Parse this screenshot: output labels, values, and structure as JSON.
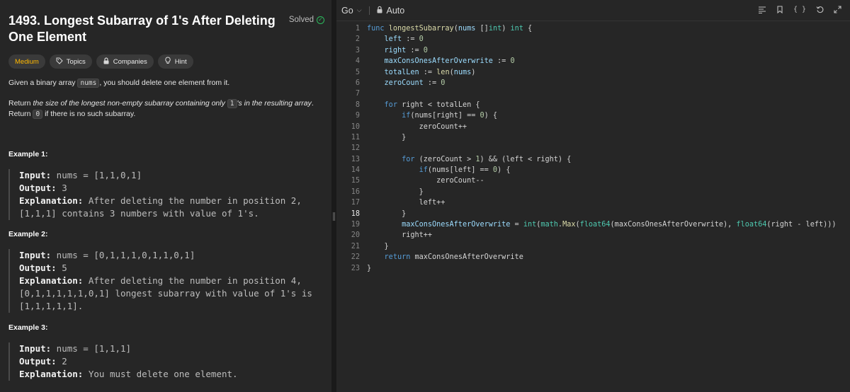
{
  "problem": {
    "title": "1493. Longest Subarray of 1's After Deleting One Element",
    "status": "Solved",
    "tags": {
      "difficulty": "Medium",
      "topics": "Topics",
      "companies": "Companies",
      "hint": "Hint"
    },
    "description": {
      "p1_pre": "Given a binary array ",
      "p1_code": "nums",
      "p1_post": ", you should delete one element from it.",
      "p2_pre": "Return ",
      "p2_em1": "the size of the longest non-empty subarray containing only ",
      "p2_code1": "1",
      "p2_em2": "'s in the resulting array",
      "p2_mid": ".",
      "p2_line2_pre": "Return ",
      "p2_code2": "0",
      "p2_line2_post": " if there is no such subarray."
    },
    "examples": [
      {
        "heading": "Example 1:",
        "input_label": "Input:",
        "input_value": " nums = [1,1,0,1]",
        "output_label": "Output:",
        "output_value": " 3",
        "explanation_label": "Explanation:",
        "explanation_line1": " After deleting the number in position 2,",
        "explanation_line2": "[1,1,1] contains 3 numbers with value of 1's."
      },
      {
        "heading": "Example 2:",
        "input_label": "Input:",
        "input_value": " nums = [0,1,1,1,0,1,1,0,1]",
        "output_label": "Output:",
        "output_value": " 5",
        "explanation_label": "Explanation:",
        "explanation_line1": " After deleting the number in position 4,",
        "explanation_line2": "[0,1,1,1,1,1,0,1] longest subarray with value of 1's is",
        "explanation_line3": "[1,1,1,1,1]."
      },
      {
        "heading": "Example 3:",
        "input_label": "Input:",
        "input_value": " nums = [1,1,1]",
        "output_label": "Output:",
        "output_value": " 2",
        "explanation_label": "Explanation:",
        "explanation_line1": " You must delete one element."
      }
    ]
  },
  "editor": {
    "language": "Go",
    "mode": "Auto",
    "current_line": 18,
    "icons": [
      "format-icon",
      "bookmark-icon",
      "braces-icon",
      "reset-icon",
      "expand-icon"
    ]
  }
}
